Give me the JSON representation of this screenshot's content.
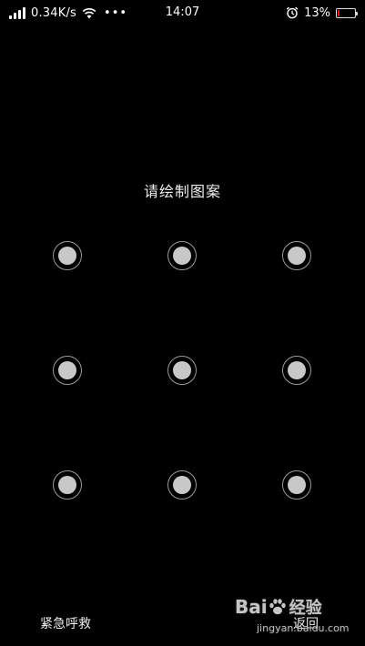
{
  "status_bar": {
    "network_speed": "0.34K/s",
    "more_indicator": "•••",
    "time": "14:07",
    "battery_percent": "13%",
    "battery_level": 0.13,
    "battery_color": "#e02020",
    "icons": [
      "signal-icon",
      "wifi-icon",
      "alarm-icon",
      "battery-icon"
    ]
  },
  "lock_screen": {
    "prompt": "请绘制图案",
    "pattern_nodes": 9,
    "node_color": "#c8c8c8"
  },
  "bottom_actions": {
    "emergency_call": "紧急呼救",
    "back": "返回"
  },
  "watermark": {
    "logo_text": "Bai",
    "logo_suffix": "经验",
    "url": "jingyan.baidu.com"
  }
}
